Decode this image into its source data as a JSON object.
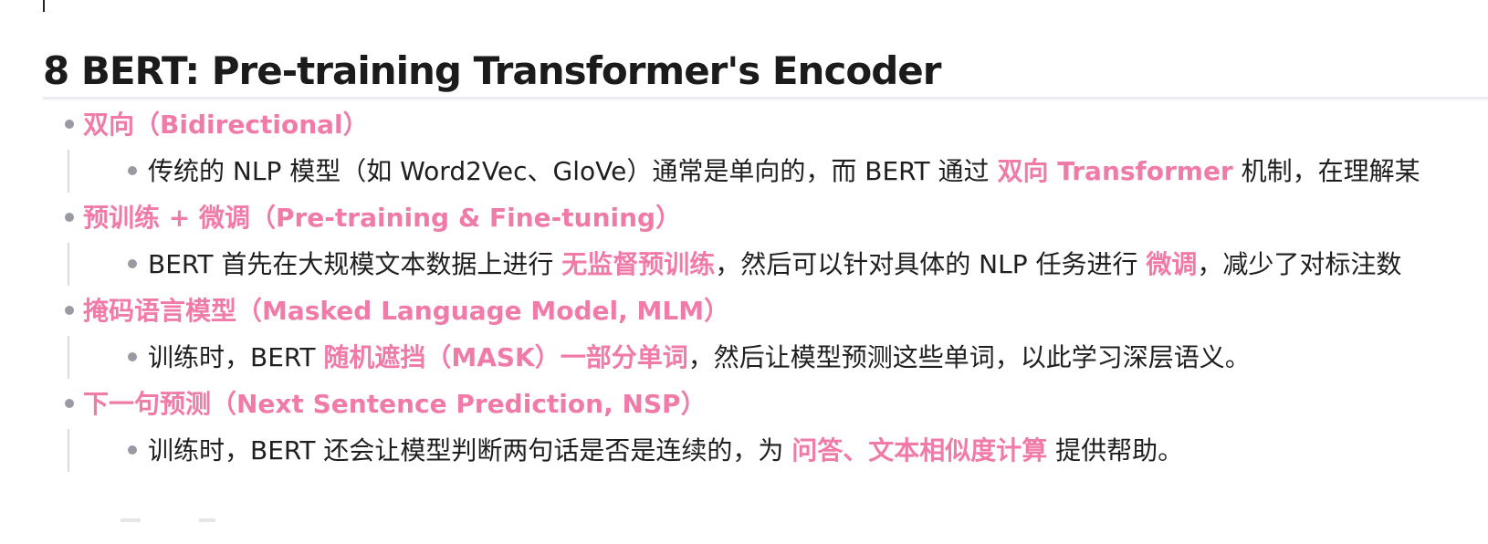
{
  "heading": "8 BERT: Pre-training Transformer's Encoder",
  "items": [
    {
      "title": "双向（Bidirectional）",
      "detail": {
        "before": "传统的 NLP 模型（如 Word2Vec、GloVe）通常是单向的，而 BERT 通过 ",
        "highlight": "双向 Transformer",
        "after": " 机制，在理解某"
      }
    },
    {
      "title": "预训练 + 微调（Pre-training & Fine-tuning）",
      "detail": {
        "before": "BERT 首先在大规模文本数据上进行 ",
        "highlight": "无监督预训练",
        "middle": "，然后可以针对具体的 NLP 任务进行 ",
        "highlight2": "微调",
        "after": "，减少了对标注数"
      }
    },
    {
      "title": "掩码语言模型（Masked Language Model, MLM）",
      "detail": {
        "before": "训练时，BERT ",
        "highlight": "随机遮挡（MASK）一部分单词",
        "after": "，然后让模型预测这些单词，以此学习深层语义。"
      }
    },
    {
      "title": "下一句预测（Next Sentence Prediction, NSP）",
      "detail": {
        "before": "训练时，BERT 还会让模型判断两句话是否是连续的，为 ",
        "highlight": "问答、文本相似度计算",
        "after": " 提供帮助。"
      }
    }
  ],
  "colors": {
    "accent": "#f07aa8",
    "text": "#1f1f1f",
    "bullet": "#9a9aa2",
    "guide": "#dadade"
  }
}
